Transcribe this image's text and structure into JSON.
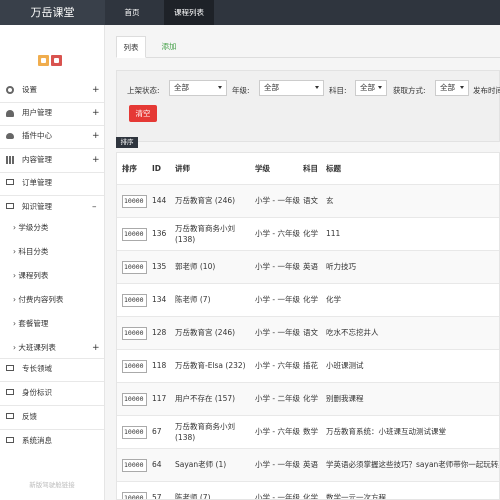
{
  "brand": "万岳课堂",
  "nav": {
    "home": "首页",
    "courses": "课程列表"
  },
  "sidebar": {
    "items": [
      {
        "label": "设置",
        "icon": "gear-icon",
        "expand": "+"
      },
      {
        "label": "用户管理",
        "icon": "user-icon",
        "expand": "+"
      },
      {
        "label": "插件中心",
        "icon": "cloud-icon",
        "expand": "+"
      },
      {
        "label": "内容管理",
        "icon": "grid-icon",
        "expand": "+"
      },
      {
        "label": "订单管理",
        "icon": "monitor-icon",
        "expand": ""
      },
      {
        "label": "知识管理",
        "icon": "monitor-icon",
        "expand": "–"
      }
    ],
    "sub_items": [
      {
        "label": "学级分类",
        "expand": ""
      },
      {
        "label": "科目分类",
        "expand": ""
      },
      {
        "label": "课程列表",
        "expand": ""
      },
      {
        "label": "付费内容列表",
        "expand": ""
      },
      {
        "label": "套餐管理",
        "expand": ""
      },
      {
        "label": "大班课列表",
        "expand": "+"
      }
    ],
    "bottom_items": [
      {
        "label": "专长领域",
        "icon": "monitor-icon"
      },
      {
        "label": "身份标识",
        "icon": "monitor-icon"
      },
      {
        "label": "反馈",
        "icon": "monitor-icon"
      },
      {
        "label": "系统消息",
        "icon": "monitor-icon"
      }
    ],
    "footer": "新版驾驶舱链接"
  },
  "tabs": {
    "list": "列表",
    "add": "添加"
  },
  "filters": {
    "status_label": "上架状态:",
    "status_value": "全部",
    "grade_label": "年级:",
    "grade_value": "全部",
    "subject_label": "科目:",
    "subject_value": "全部",
    "acquire_label": "获取方式:",
    "acquire_value": "全部",
    "publish_label": "发布时间",
    "clear": "清空"
  },
  "sort_button": "排序",
  "table": {
    "headers": {
      "sort": "排序",
      "id": "ID",
      "teacher": "讲师",
      "grade": "学级",
      "subject": "科目",
      "title": "标题"
    },
    "rows": [
      {
        "sort": "10000",
        "id": "144",
        "teacher": "万岳教育宫 (246)",
        "grade": "小学 - 一年级",
        "subject": "语文",
        "title": "玄"
      },
      {
        "sort": "10000",
        "id": "136",
        "teacher": "万岳教育商务小刘 (138)",
        "grade": "小学 - 六年级",
        "subject": "化学",
        "title": "111"
      },
      {
        "sort": "10000",
        "id": "135",
        "teacher": "郭老师 (10)",
        "grade": "小学 - 一年级",
        "subject": "英语",
        "title": "听力技巧"
      },
      {
        "sort": "10000",
        "id": "134",
        "teacher": "陈老师 (7)",
        "grade": "小学 - 一年级",
        "subject": "化学",
        "title": "化学"
      },
      {
        "sort": "10000",
        "id": "128",
        "teacher": "万岳教育宫 (246)",
        "grade": "小学 - 一年级",
        "subject": "语文",
        "title": "吃水不忘挖井人"
      },
      {
        "sort": "10000",
        "id": "118",
        "teacher": "万岳教育-Elsa (232)",
        "grade": "小学 - 六年级",
        "subject": "插花",
        "title": "小班课测试"
      },
      {
        "sort": "10000",
        "id": "117",
        "teacher": "用户不存在 (157)",
        "grade": "小学 - 二年级",
        "subject": "化学",
        "title": "别删我课程"
      },
      {
        "sort": "10000",
        "id": "67",
        "teacher": "万岳教育商务小刘 (138)",
        "grade": "小学 - 六年级",
        "subject": "数学",
        "title": "万岳教育系统：小班课互动测试课堂"
      },
      {
        "sort": "10000",
        "id": "64",
        "teacher": "Sayan老师 (1)",
        "grade": "小学 - 一年级",
        "subject": "英语",
        "title": "学英语必须掌握这些技巧？sayan老师带你一起玩转英语"
      },
      {
        "sort": "10000",
        "id": "57",
        "teacher": "陈老师 (7)",
        "grade": "小学 - 一年级",
        "subject": "化学",
        "title": "数学一元一次方程"
      }
    ]
  }
}
